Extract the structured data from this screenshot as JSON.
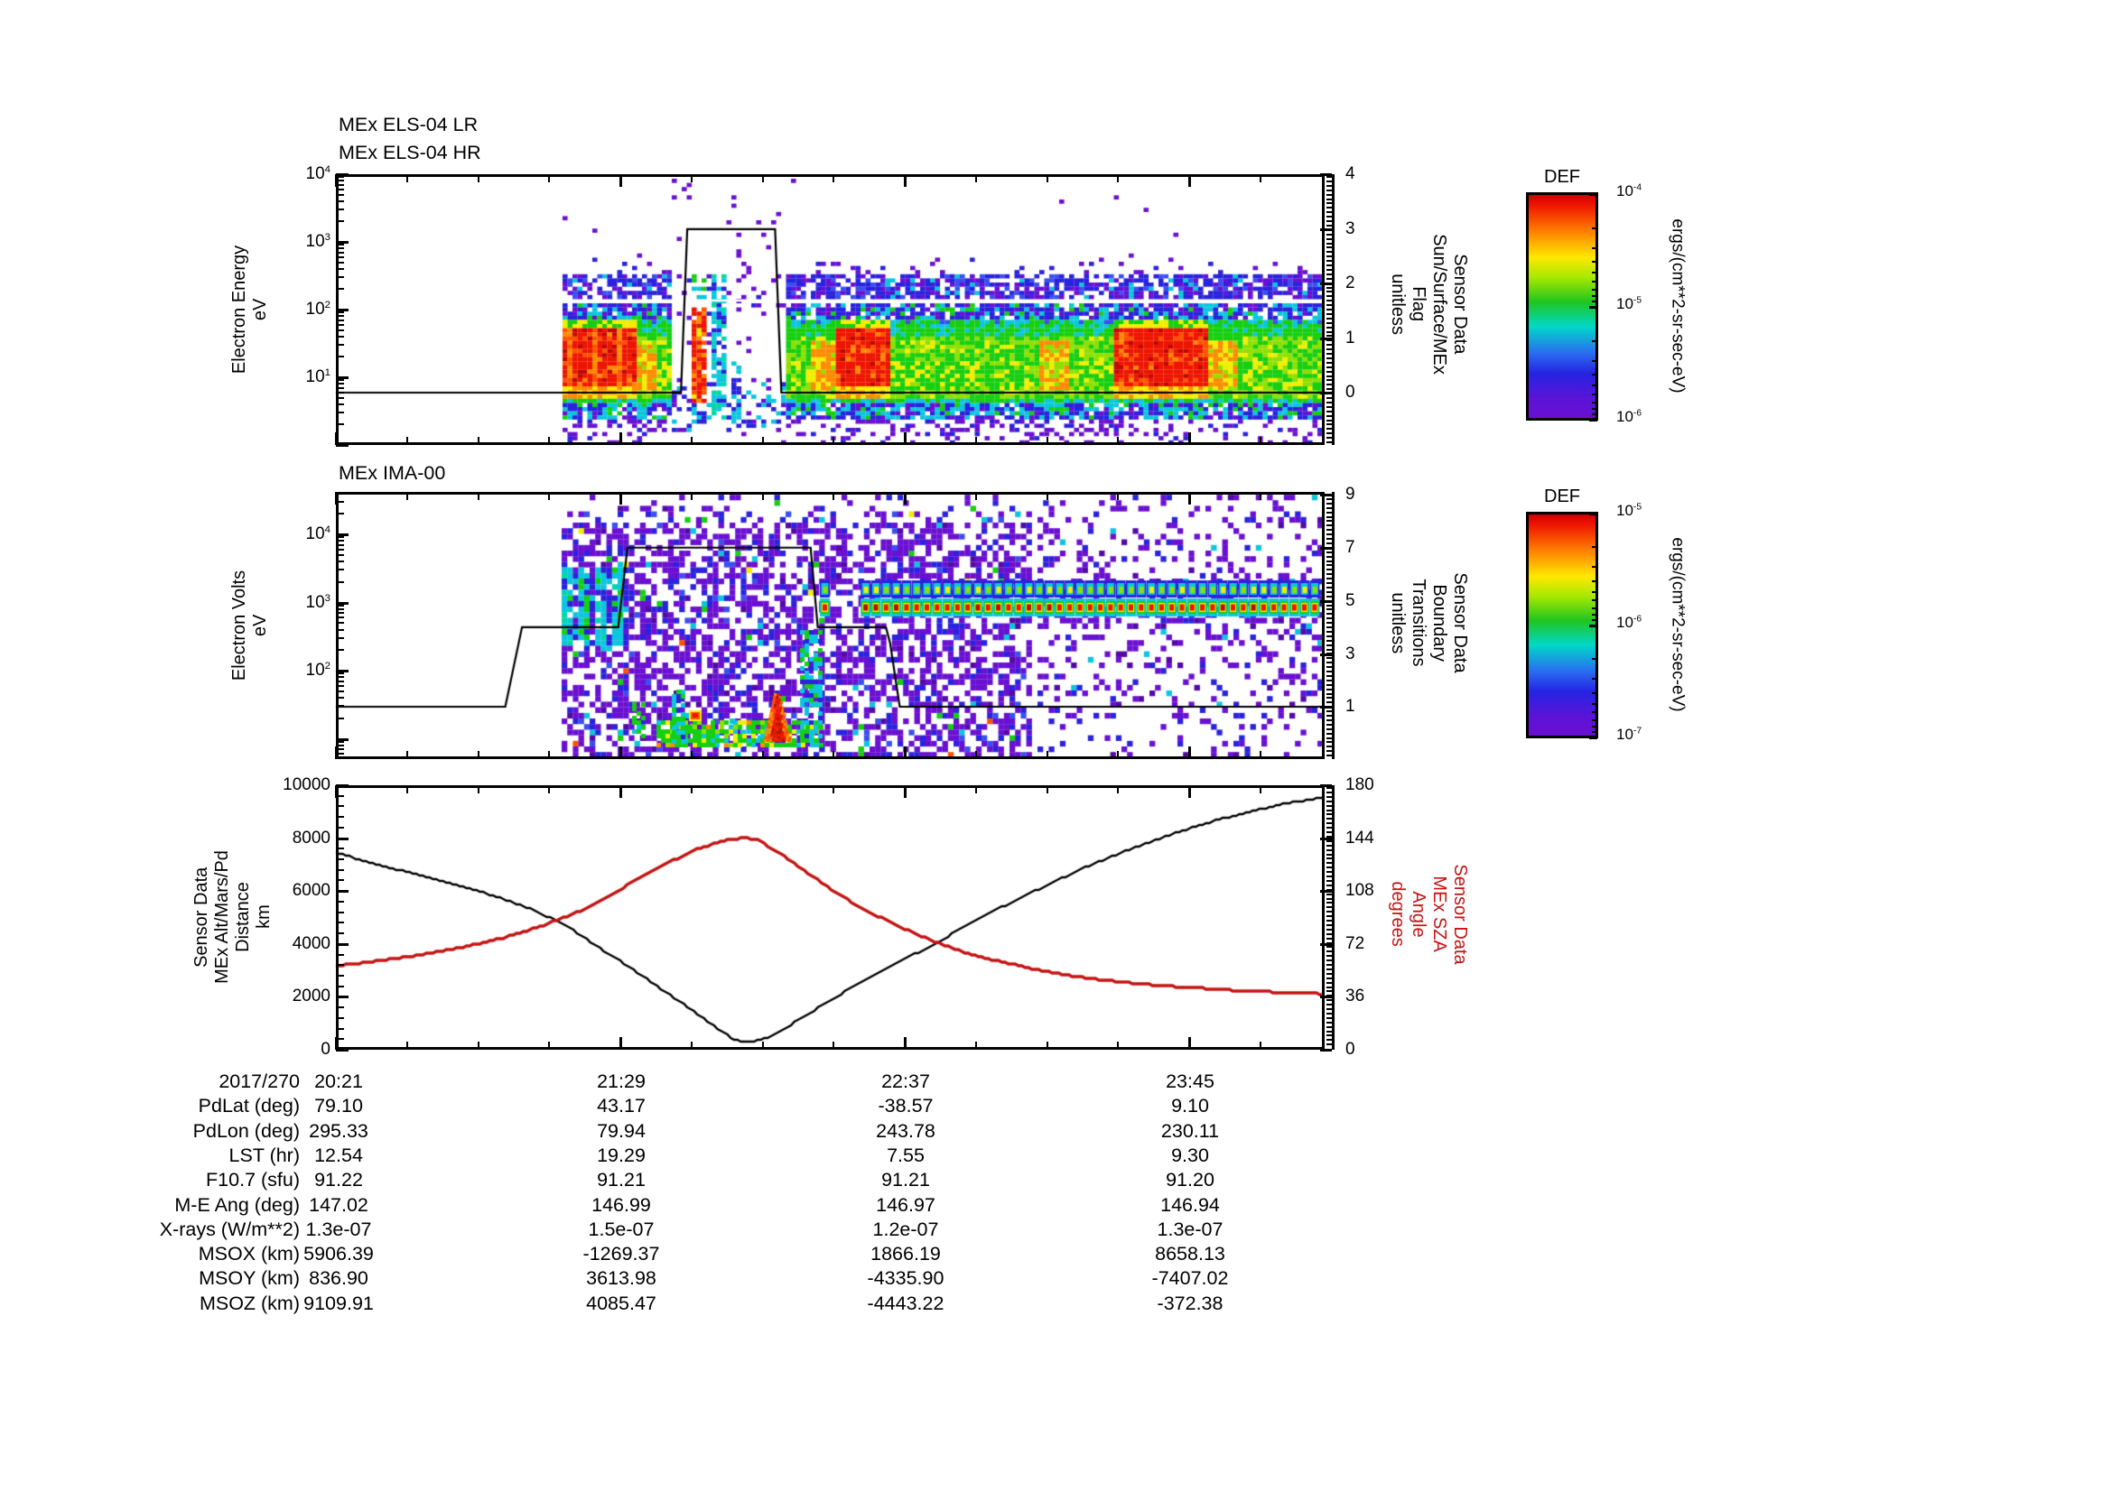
{
  "panels": {
    "els": {
      "titles": [
        "MEx ELS-04 LR",
        "MEx ELS-04 HR"
      ],
      "ylabel": "Electron Energy\neV",
      "ytick_exps": [
        "4",
        "3",
        "2",
        "1"
      ],
      "right_label": "Sensor Data\nSun/Surface/MEx\nFlag\nunitless",
      "right_ticks": [
        "4",
        "3",
        "2",
        "1",
        "0"
      ]
    },
    "ima": {
      "title": "MEx IMA-00",
      "ylabel": "Electron Volts\neV",
      "ytick_exps": [
        "4",
        "3",
        "2"
      ],
      "right_label": "Sensor Data\nBoundary\nTransitions\nunitless",
      "right_ticks": [
        "9",
        "7",
        "5",
        "3",
        "1"
      ]
    },
    "traj": {
      "left_label": "Sensor Data\nMEx Alt/Mars/Pd\nDistance\nkm",
      "left_ticks": [
        "10000",
        "8000",
        "6000",
        "4000",
        "2000",
        "0"
      ],
      "right_label": "Sensor Data\nMEx SZA\nAngle\ndegrees",
      "right_ticks": [
        "180",
        "144",
        "108",
        "72",
        "36",
        "0"
      ],
      "right_color": "#c41414"
    }
  },
  "colorbars": [
    {
      "title": "DEF",
      "tick_exps": [
        "-4",
        "-5",
        "-6"
      ],
      "units": "ergs/(cm**2-sr-sec-eV)"
    },
    {
      "title": "DEF",
      "tick_exps": [
        "-5",
        "-6",
        "-7"
      ],
      "units": "ergs/(cm**2-sr-sec-eV)"
    }
  ],
  "table": {
    "rows": [
      {
        "label": "2017/270",
        "values": [
          "20:21",
          "21:29",
          "22:37",
          "23:45"
        ]
      },
      {
        "label": "PdLat (deg)",
        "values": [
          "79.10",
          "43.17",
          "-38.57",
          "9.10"
        ]
      },
      {
        "label": "PdLon (deg)",
        "values": [
          "295.33",
          "79.94",
          "243.78",
          "230.11"
        ]
      },
      {
        "label": "LST (hr)",
        "values": [
          "12.54",
          "19.29",
          "7.55",
          "9.30"
        ]
      },
      {
        "label": "F10.7 (sfu)",
        "values": [
          "91.22",
          "91.21",
          "91.21",
          "91.20"
        ]
      },
      {
        "label": "M-E Ang (deg)",
        "values": [
          "147.02",
          "146.99",
          "146.97",
          "146.94"
        ]
      },
      {
        "label": "X-rays (W/m**2)",
        "values": [
          "1.3e-07",
          "1.5e-07",
          "1.2e-07",
          "1.3e-07"
        ]
      },
      {
        "label": "MSOX (km)",
        "values": [
          "5906.39",
          "-1269.37",
          "1866.19",
          "8658.13"
        ]
      },
      {
        "label": "MSOY (km)",
        "values": [
          "836.90",
          "3613.98",
          "-4335.90",
          "-7407.02"
        ]
      },
      {
        "label": "MSOZ (km)",
        "values": [
          "9109.91",
          "4085.47",
          "-4443.22",
          "-372.38"
        ]
      }
    ]
  },
  "chart_data": [
    {
      "type": "heatmap",
      "title": "MEx ELS-04 LR / MEx ELS-04 HR electron spectrogram",
      "ylabel": "Electron Energy eV",
      "yrange_ev": [
        1,
        10000
      ],
      "x_start": "2017/270 20:21",
      "xticks": [
        "20:21",
        "21:29",
        "22:37",
        "23:45"
      ],
      "data_begins_min_after_start": 54,
      "colorbar": {
        "title": "DEF",
        "units": "ergs/(cm**2-sr-sec-eV)",
        "range": [
          "1e-6",
          "1e-4"
        ]
      },
      "features": "Intense 10-100 eV sheath electrons (red ~1e-4) near 21:15-21:40 and 22:20-22:40; persistent 10-100 eV green band to end; blue 100-500 eV halo; white photoelectron line ~150 eV; data gap with narrow red/cyan columns ~21:43-22:06",
      "overlay_flag_steps_t_v": [
        [
          0,
          0
        ],
        [
          82.5,
          0
        ],
        [
          84,
          3
        ],
        [
          105,
          3
        ],
        [
          106.5,
          0
        ],
        [
          236.4,
          0
        ]
      ],
      "overlay_name": "Sun/Surface/MEx Flag (0-4)"
    },
    {
      "type": "heatmap",
      "title": "MEx IMA-00 ion spectrogram",
      "ylabel": "Electron Volts eV",
      "yrange_ev": [
        5,
        42000
      ],
      "x_start": "2017/270 20:21",
      "xticks": [
        "20:21",
        "21:29",
        "22:37",
        "23:45"
      ],
      "colorbar": {
        "title": "DEF",
        "units": "ergs/(cm**2-sr-sec-eV)",
        "range": [
          "1e-7",
          "1e-5"
        ]
      },
      "features": "Dense violet/blue counts 21:15-23:07; cyan columns 0.3-3 keV near 21:15-21:30; low-energy (~30 eV) green/red ionospheric band 21:37-22:17 with red spike ~22:06; periodic red beam ~800 eV and cyan/yellow beam ~1.6 keV from ~22:18 to end; sparser counts after 23:08",
      "overlay_boundary_steps_t_v": [
        [
          0,
          1
        ],
        [
          40.5,
          1
        ],
        [
          44.5,
          4
        ],
        [
          67.5,
          4
        ],
        [
          69.7,
          7
        ],
        [
          113.5,
          7
        ],
        [
          115.2,
          4
        ],
        [
          131.5,
          4
        ],
        [
          132.5,
          3.4
        ],
        [
          134.8,
          1
        ],
        [
          236.4,
          1
        ]
      ],
      "overlay_name": "Boundary Transitions (1-9)"
    },
    {
      "type": "line",
      "xticks": [
        "20:21",
        "21:29",
        "22:37",
        "23:45"
      ],
      "x_minutes_span": [
        0,
        236.4
      ],
      "ylim_left_km": [
        0,
        10000
      ],
      "ylim_right_deg": [
        0,
        180
      ],
      "series": [
        {
          "name": "MEx Alt/Mars/Pd Distance km",
          "color": "#000000",
          "axis": "left",
          "points": [
            [
              0,
              7450
            ],
            [
              10,
              7000
            ],
            [
              20,
              6600
            ],
            [
              31,
              6150
            ],
            [
              40,
              5700
            ],
            [
              47,
              5300
            ],
            [
              55,
              4700
            ],
            [
              62,
              3950
            ],
            [
              68,
              3350
            ],
            [
              75,
              2600
            ],
            [
              81,
              1950
            ],
            [
              87,
              1300
            ],
            [
              92,
              700
            ],
            [
              95,
              420
            ],
            [
              97,
              310
            ],
            [
              100,
              300
            ],
            [
              104,
              520
            ],
            [
              110,
              1060
            ],
            [
              116,
              1650
            ],
            [
              125,
              2520
            ],
            [
              133,
              3200
            ],
            [
              141,
              3820
            ],
            [
              150,
              4620
            ],
            [
              160,
              5460
            ],
            [
              170,
              6220
            ],
            [
              180,
              6960
            ],
            [
              190,
              7600
            ],
            [
              200,
              8160
            ],
            [
              210,
              8660
            ],
            [
              220,
              9060
            ],
            [
              228,
              9340
            ],
            [
              236,
              9530
            ]
          ]
        },
        {
          "name": "MEx SZA Angle degrees",
          "color": "#c41414",
          "axis": "right",
          "points": [
            [
              0,
              57
            ],
            [
              10,
              60.5
            ],
            [
              20,
              64.5
            ],
            [
              30,
              69.5
            ],
            [
              40,
              76
            ],
            [
              50,
              85
            ],
            [
              58,
              94
            ],
            [
              66,
              106
            ],
            [
              74,
              119
            ],
            [
              80,
              128
            ],
            [
              86,
              136
            ],
            [
              91,
              141
            ],
            [
              95,
              143.5
            ],
            [
              98,
              144
            ],
            [
              101,
              142.5
            ],
            [
              106,
              134
            ],
            [
              110,
              126
            ],
            [
              115,
              116
            ],
            [
              120,
              106
            ],
            [
              126,
              96
            ],
            [
              132,
              87.5
            ],
            [
              138,
              79.5
            ],
            [
              144,
              72.5
            ],
            [
              150,
              66.5
            ],
            [
              158,
              60.5
            ],
            [
              166,
              55.5
            ],
            [
              174,
              51
            ],
            [
              182,
              48
            ],
            [
              190,
              45.5
            ],
            [
              198,
              43.5
            ],
            [
              206,
              42
            ],
            [
              214,
              40.5
            ],
            [
              222,
              39.5
            ],
            [
              230,
              38.5
            ],
            [
              236,
              38
            ]
          ]
        }
      ]
    }
  ]
}
